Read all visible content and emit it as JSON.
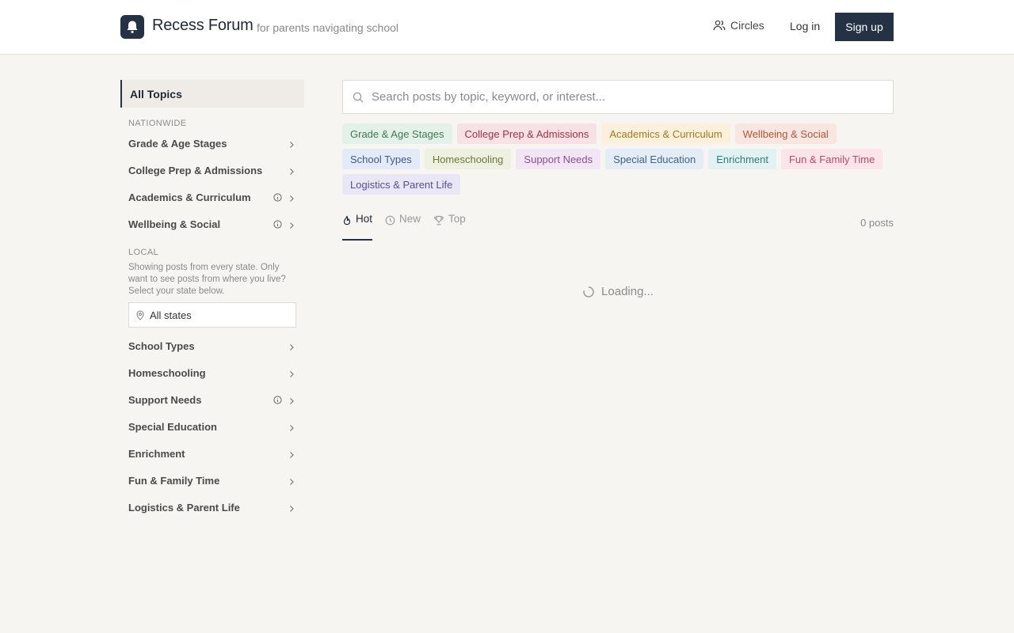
{
  "header": {
    "brand": "Recess Forum",
    "tagline": "for parents navigating school",
    "nav_circles": "Circles",
    "nav_login": "Log in",
    "nav_signup": "Sign up",
    "logo_icon": "bell-icon"
  },
  "sidebar": {
    "all_topics": "All Topics",
    "nationwide_label": "NATIONWIDE",
    "nationwide_items": [
      {
        "label": "Grade & Age Stages",
        "info": false
      },
      {
        "label": "College Prep & Admissions",
        "info": false
      },
      {
        "label": "Academics & Curriculum",
        "info": true
      },
      {
        "label": "Wellbeing & Social",
        "info": true
      }
    ],
    "local_label": "LOCAL",
    "local_help": "Showing posts from every state. Only want to see posts from where you live? Select your state below.",
    "state_value": "All states",
    "local_items": [
      {
        "label": "School Types",
        "info": false
      },
      {
        "label": "Homeschooling",
        "info": false
      },
      {
        "label": "Support Needs",
        "info": true
      },
      {
        "label": "Special Education",
        "info": false
      },
      {
        "label": "Enrichment",
        "info": false
      },
      {
        "label": "Fun & Family Time",
        "info": false
      },
      {
        "label": "Logistics & Parent Life",
        "info": false
      }
    ]
  },
  "main": {
    "search_placeholder": "Search posts by topic, keyword, or interest...",
    "chips": [
      {
        "label": "Grade & Age Stages",
        "bg": "#e4f1e8",
        "fg": "#3e7a55"
      },
      {
        "label": "College Prep & Admissions",
        "bg": "#f8e1e5",
        "fg": "#9c3348"
      },
      {
        "label": "Academics & Curriculum",
        "bg": "#fbf0dc",
        "fg": "#a8761f"
      },
      {
        "label": "Wellbeing & Social",
        "bg": "#fae6e0",
        "fg": "#b5543b"
      },
      {
        "label": "School Types",
        "bg": "#e4ebf8",
        "fg": "#3d5a94"
      },
      {
        "label": "Homeschooling",
        "bg": "#eef1e0",
        "fg": "#6b7a38"
      },
      {
        "label": "Support Needs",
        "bg": "#f3e6f4",
        "fg": "#8a4f91"
      },
      {
        "label": "Special Education",
        "bg": "#e4edf6",
        "fg": "#3e6388"
      },
      {
        "label": "Enrichment",
        "bg": "#e2f1f1",
        "fg": "#2f7b7f"
      },
      {
        "label": "Fun & Family Time",
        "bg": "#fbe4ea",
        "fg": "#b44c6b"
      },
      {
        "label": "Logistics & Parent Life",
        "bg": "#e9e6f6",
        "fg": "#56509a"
      }
    ],
    "tabs": [
      {
        "label": "Hot",
        "icon": "flame-icon",
        "active": true
      },
      {
        "label": "New",
        "icon": "clock-icon",
        "active": false
      },
      {
        "label": "Top",
        "icon": "trophy-icon",
        "active": false
      }
    ],
    "post_count": "0 posts",
    "loading_text": "Loading..."
  }
}
